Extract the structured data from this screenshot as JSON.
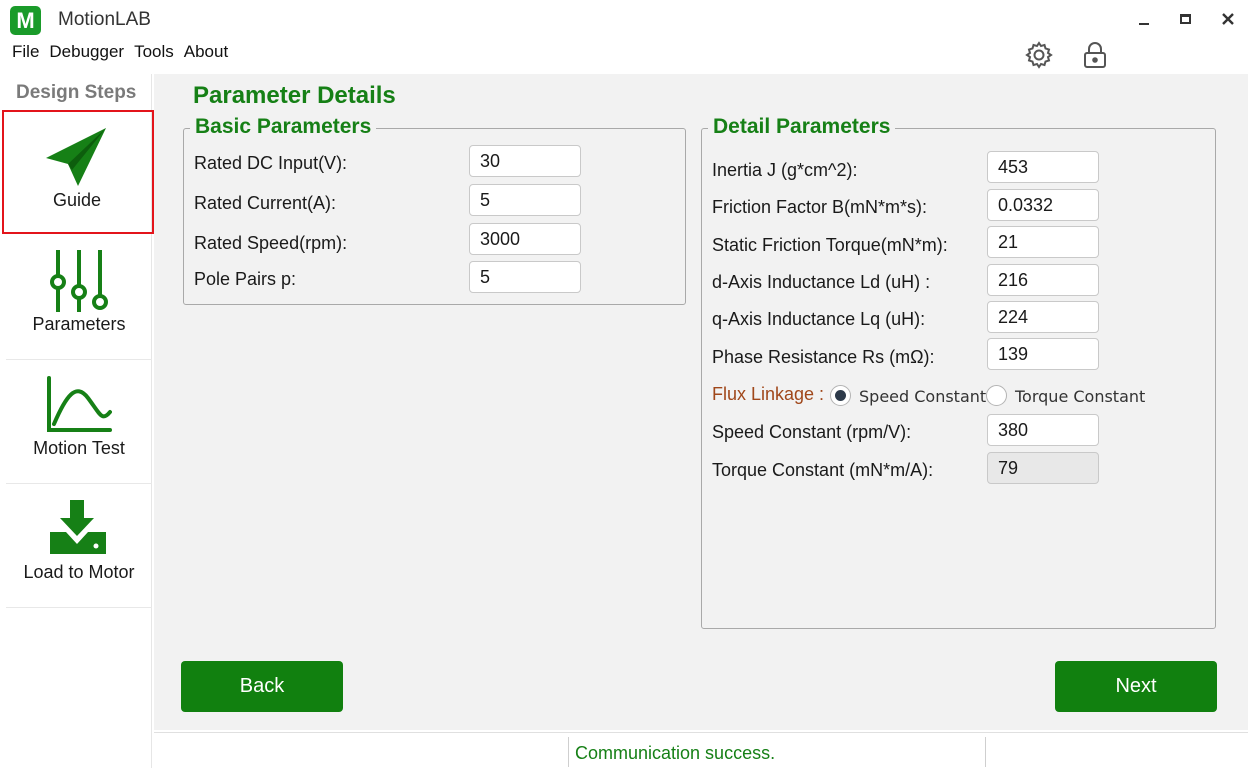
{
  "app": {
    "logo_letter": "M",
    "title": "MotionLAB"
  },
  "menu": [
    "File",
    "Debugger",
    "Tools",
    "About"
  ],
  "icons": {
    "settings": "gear-icon",
    "lock": "lock-icon"
  },
  "sidebar": {
    "title": "Design Steps",
    "items": [
      {
        "label": "Guide",
        "icon": "paper-plane-icon",
        "active": true
      },
      {
        "label": "Parameters",
        "icon": "sliders-icon",
        "active": false
      },
      {
        "label": "Motion Test",
        "icon": "chart-curve-icon",
        "active": false
      },
      {
        "label": "Load to Motor",
        "icon": "download-icon",
        "active": false
      }
    ]
  },
  "main": {
    "title": "Parameter Details",
    "basic": {
      "legend": "Basic Parameters",
      "rows": [
        {
          "label": "Rated DC Input(V):",
          "value": "30"
        },
        {
          "label": "Rated Current(A):",
          "value": "5"
        },
        {
          "label": "Rated Speed(rpm):",
          "value": "3000"
        },
        {
          "label": "Pole Pairs p:",
          "value": "5"
        }
      ]
    },
    "detail": {
      "legend": "Detail Parameters",
      "rows": [
        {
          "label": "Inertia J (g*cm^2):",
          "value": "453"
        },
        {
          "label": "Friction Factor B(mN*m*s):",
          "value": "0.0332"
        },
        {
          "label": "Static Friction Torque(mN*m):",
          "value": "21"
        },
        {
          "label": "d-Axis Inductance Ld (uH) :",
          "value": "216"
        },
        {
          "label": "q-Axis Inductance Lq (uH):",
          "value": "224"
        },
        {
          "label": "Phase Resistance Rs (mΩ):",
          "value": "139"
        }
      ],
      "flux": {
        "label": "Flux Linkage :",
        "options": [
          "Speed Constant",
          "Torque Constant"
        ],
        "selected": "Speed Constant"
      },
      "speed_constant": {
        "label": "Speed Constant (rpm/V):",
        "value": "380"
      },
      "torque_constant": {
        "label": "Torque Constant (mN*m/A):",
        "value": "79"
      }
    },
    "back_label": "Back",
    "next_label": "Next"
  },
  "status": {
    "message": "Communication success."
  },
  "colors": {
    "accent": "#168016",
    "button": "#11800f",
    "highlight": "#e3141b",
    "flux_label": "#a0471a"
  }
}
